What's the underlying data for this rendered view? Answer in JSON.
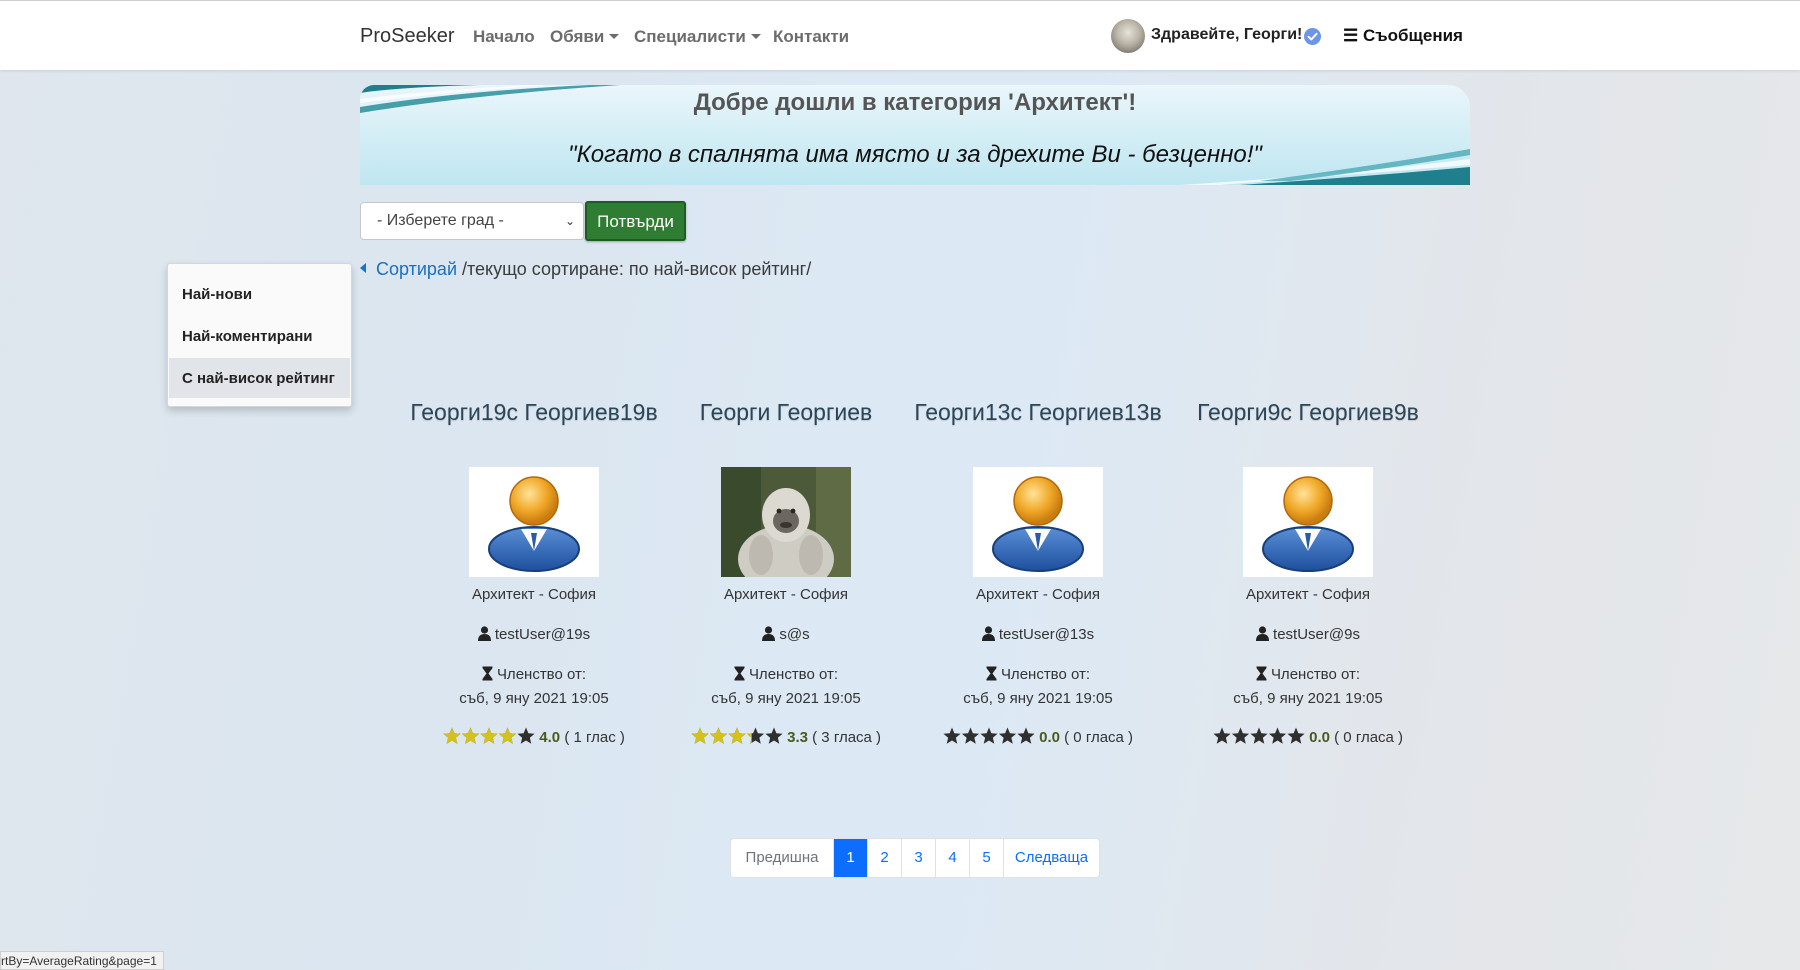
{
  "navbar": {
    "brand": "ProSeeker",
    "links": [
      "Начало",
      "Обяви",
      "Специалисти",
      "Контакти"
    ],
    "greeting": "Здравейте, Георги!",
    "messages": "☰ Съобщения"
  },
  "banner": {
    "title": "Добре дошли в категория 'Архитект'!",
    "quote": "\"Когато в спалнята има място и за дрехите Ви - безценно!\""
  },
  "filter": {
    "city_placeholder": "- Изберете град -",
    "confirm_label": "Потвърди"
  },
  "sort": {
    "link": "Сортирай",
    "current": " /текущо сортиране: по най-висок рейтинг/",
    "options": [
      "Най-нови",
      "Най-коментирани",
      "С най-висок рейтинг"
    ],
    "selected": "С най-висок рейтинг"
  },
  "specialists": [
    {
      "name": "Георги19с Георгиев19в",
      "category": "Архитект - София",
      "username": "testUser@19s",
      "member_label": "Членство от:",
      "member_since": "съб, 9 яну 2021 19:05",
      "rating": 4.0,
      "rating_text": "4.0",
      "votes": "( 1 глас )",
      "avatar": "default-user-icon"
    },
    {
      "name": "Георги Георгиев",
      "category": "Архитект - София",
      "username": "s@s",
      "member_label": "Членство от:",
      "member_since": "съб, 9 яну 2021 19:05",
      "rating": 3.3,
      "rating_text": "3.3",
      "votes": "( 3 гласа )",
      "avatar": "gorilla-photo"
    },
    {
      "name": "Георги13с Георгиев13в",
      "category": "Архитект - София",
      "username": "testUser@13s",
      "member_label": "Членство от:",
      "member_since": "съб, 9 яну 2021 19:05",
      "rating": 0.0,
      "rating_text": "0.0",
      "votes": "( 0 гласа )",
      "avatar": "default-user-icon"
    },
    {
      "name": "Георги9с Георгиев9в",
      "category": "Архитект - София",
      "username": "testUser@9s",
      "member_label": "Членство от:",
      "member_since": "съб, 9 яну 2021 19:05",
      "rating": 0.0,
      "rating_text": "0.0",
      "votes": "( 0 гласа )",
      "avatar": "default-user-icon"
    }
  ],
  "pagination": {
    "prev": "Предишна",
    "pages": [
      "1",
      "2",
      "3",
      "4",
      "5"
    ],
    "current": "1",
    "next": "Следваща"
  },
  "status_url": "rtBy=AverageRating&page=1",
  "colors": {
    "star_filled": "#d4c21a",
    "star_empty": "#2f2f2f",
    "link": "#0d6efd",
    "confirm_button": "#2e7d32"
  }
}
